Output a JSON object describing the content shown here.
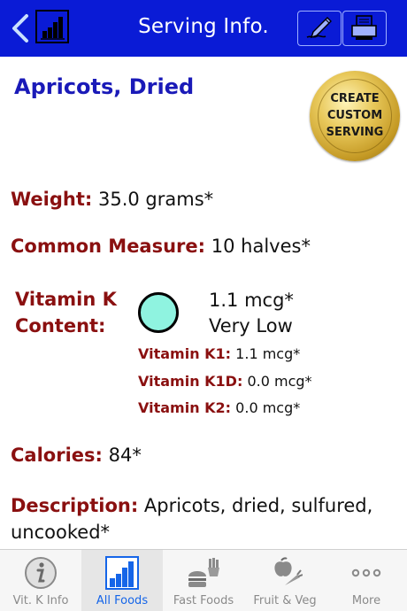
{
  "header": {
    "title": "Serving Info.",
    "back_icon": "chevron-left-icon",
    "left_icon": "bar-chart-icon",
    "right_icons": [
      "edit-pen-icon",
      "printer-icon"
    ],
    "colors": {
      "bar": "#0a1bd6",
      "text": "#ffffff"
    }
  },
  "food": {
    "name": "Apricots, Dried",
    "create_button": "CREATE\nCUSTOM\nSERVING"
  },
  "details": {
    "weight_label": "Weight:",
    "weight_value": "35.0 grams*",
    "measure_label": "Common Measure:",
    "measure_value": "10 halves*",
    "vitk_label": "Vitamin K\nContent:",
    "vitk_amount": "1.1 mcg*",
    "vitk_level": "Very Low",
    "vitk_indicator_color": "#8ff3e0",
    "sub_values": [
      {
        "label": "Vitamin K1:",
        "value": "1.1 mcg*"
      },
      {
        "label": "Vitamin K1D:",
        "value": "0.0 mcg*"
      },
      {
        "label": "Vitamin K2:",
        "value": "0.0 mcg*"
      }
    ],
    "calories_label": "Calories:",
    "calories_value": "84*",
    "description_label": "Description:",
    "description_value": "Apricots, dried, sulfured, uncooked*"
  },
  "tabbar": {
    "active_index": 1,
    "tabs": [
      {
        "label": "Vit. K Info",
        "icon": "info-icon"
      },
      {
        "label": "All Foods",
        "icon": "bar-chart-icon"
      },
      {
        "label": "Fast Foods",
        "icon": "burger-fries-icon"
      },
      {
        "label": "Fruit & Veg",
        "icon": "apple-carrot-icon"
      },
      {
        "label": "More",
        "icon": "more-dots-icon"
      }
    ]
  }
}
